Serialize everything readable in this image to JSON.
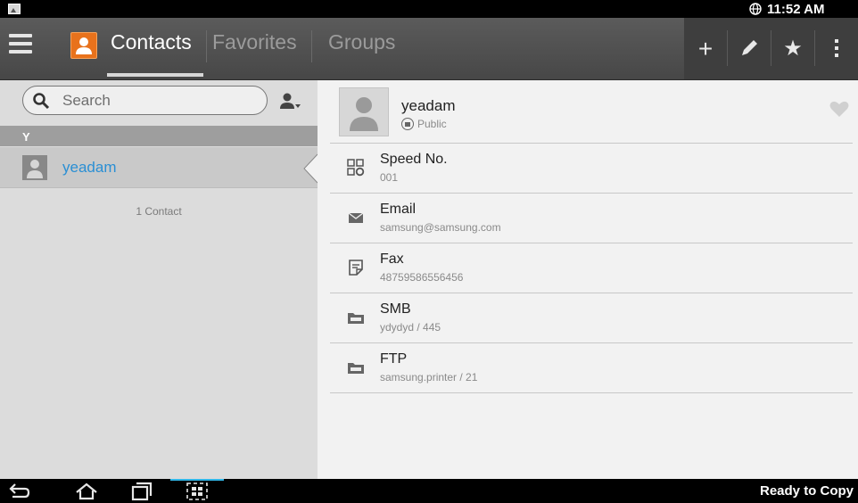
{
  "status_bar": {
    "time": "11:52 AM",
    "icons": [
      "picture-icon",
      "globe-icon"
    ]
  },
  "action_bar": {
    "tabs": [
      {
        "label": "Contacts",
        "selected": true
      },
      {
        "label": "Favorites",
        "selected": false
      },
      {
        "label": "Groups",
        "selected": false
      }
    ],
    "buttons": [
      "add-icon",
      "edit-icon",
      "star-icon",
      "overflow-menu-icon"
    ]
  },
  "left_pane": {
    "search": {
      "placeholder": "Search",
      "value": ""
    },
    "section_letter": "Y",
    "contacts": [
      {
        "name": "yeadam",
        "selected": true
      }
    ],
    "count_text": "1 Contact"
  },
  "detail": {
    "name": "yeadam",
    "access": "Public",
    "fields": [
      {
        "label": "Speed No.",
        "value": "001",
        "icon": "speed-dial-icon"
      },
      {
        "label": "Email",
        "value": "samsung@samsung.com",
        "icon": "envelope-icon"
      },
      {
        "label": "Fax",
        "value": "48759586556456",
        "icon": "fax-icon"
      },
      {
        "label": "SMB",
        "value": "ydydyd / 445",
        "icon": "smb-folder-icon"
      },
      {
        "label": "FTP",
        "value": "samsung.printer / 21",
        "icon": "ftp-folder-icon"
      }
    ]
  },
  "nav_bar": {
    "buttons": [
      "back-icon",
      "home-icon",
      "recent-apps-icon",
      "screen-capture-icon"
    ],
    "status_text": "Ready to Copy"
  },
  "colors": {
    "accent_blue": "#2a8fd4",
    "app_icon_orange": "#e8721c",
    "nav_highlight": "#31b6e7"
  }
}
